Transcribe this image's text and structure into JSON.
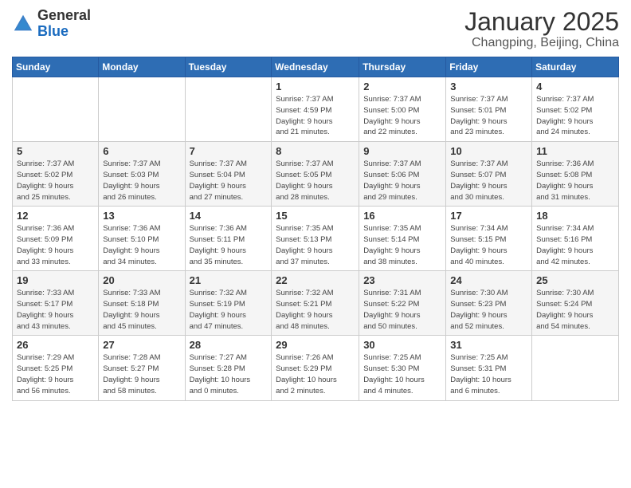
{
  "header": {
    "logo_general": "General",
    "logo_blue": "Blue",
    "month_year": "January 2025",
    "location": "Changping, Beijing, China"
  },
  "weekdays": [
    "Sunday",
    "Monday",
    "Tuesday",
    "Wednesday",
    "Thursday",
    "Friday",
    "Saturday"
  ],
  "weeks": [
    [
      {
        "day": "",
        "info": ""
      },
      {
        "day": "",
        "info": ""
      },
      {
        "day": "",
        "info": ""
      },
      {
        "day": "1",
        "info": "Sunrise: 7:37 AM\nSunset: 4:59 PM\nDaylight: 9 hours\nand 21 minutes."
      },
      {
        "day": "2",
        "info": "Sunrise: 7:37 AM\nSunset: 5:00 PM\nDaylight: 9 hours\nand 22 minutes."
      },
      {
        "day": "3",
        "info": "Sunrise: 7:37 AM\nSunset: 5:01 PM\nDaylight: 9 hours\nand 23 minutes."
      },
      {
        "day": "4",
        "info": "Sunrise: 7:37 AM\nSunset: 5:02 PM\nDaylight: 9 hours\nand 24 minutes."
      }
    ],
    [
      {
        "day": "5",
        "info": "Sunrise: 7:37 AM\nSunset: 5:02 PM\nDaylight: 9 hours\nand 25 minutes."
      },
      {
        "day": "6",
        "info": "Sunrise: 7:37 AM\nSunset: 5:03 PM\nDaylight: 9 hours\nand 26 minutes."
      },
      {
        "day": "7",
        "info": "Sunrise: 7:37 AM\nSunset: 5:04 PM\nDaylight: 9 hours\nand 27 minutes."
      },
      {
        "day": "8",
        "info": "Sunrise: 7:37 AM\nSunset: 5:05 PM\nDaylight: 9 hours\nand 28 minutes."
      },
      {
        "day": "9",
        "info": "Sunrise: 7:37 AM\nSunset: 5:06 PM\nDaylight: 9 hours\nand 29 minutes."
      },
      {
        "day": "10",
        "info": "Sunrise: 7:37 AM\nSunset: 5:07 PM\nDaylight: 9 hours\nand 30 minutes."
      },
      {
        "day": "11",
        "info": "Sunrise: 7:36 AM\nSunset: 5:08 PM\nDaylight: 9 hours\nand 31 minutes."
      }
    ],
    [
      {
        "day": "12",
        "info": "Sunrise: 7:36 AM\nSunset: 5:09 PM\nDaylight: 9 hours\nand 33 minutes."
      },
      {
        "day": "13",
        "info": "Sunrise: 7:36 AM\nSunset: 5:10 PM\nDaylight: 9 hours\nand 34 minutes."
      },
      {
        "day": "14",
        "info": "Sunrise: 7:36 AM\nSunset: 5:11 PM\nDaylight: 9 hours\nand 35 minutes."
      },
      {
        "day": "15",
        "info": "Sunrise: 7:35 AM\nSunset: 5:13 PM\nDaylight: 9 hours\nand 37 minutes."
      },
      {
        "day": "16",
        "info": "Sunrise: 7:35 AM\nSunset: 5:14 PM\nDaylight: 9 hours\nand 38 minutes."
      },
      {
        "day": "17",
        "info": "Sunrise: 7:34 AM\nSunset: 5:15 PM\nDaylight: 9 hours\nand 40 minutes."
      },
      {
        "day": "18",
        "info": "Sunrise: 7:34 AM\nSunset: 5:16 PM\nDaylight: 9 hours\nand 42 minutes."
      }
    ],
    [
      {
        "day": "19",
        "info": "Sunrise: 7:33 AM\nSunset: 5:17 PM\nDaylight: 9 hours\nand 43 minutes."
      },
      {
        "day": "20",
        "info": "Sunrise: 7:33 AM\nSunset: 5:18 PM\nDaylight: 9 hours\nand 45 minutes."
      },
      {
        "day": "21",
        "info": "Sunrise: 7:32 AM\nSunset: 5:19 PM\nDaylight: 9 hours\nand 47 minutes."
      },
      {
        "day": "22",
        "info": "Sunrise: 7:32 AM\nSunset: 5:21 PM\nDaylight: 9 hours\nand 48 minutes."
      },
      {
        "day": "23",
        "info": "Sunrise: 7:31 AM\nSunset: 5:22 PM\nDaylight: 9 hours\nand 50 minutes."
      },
      {
        "day": "24",
        "info": "Sunrise: 7:30 AM\nSunset: 5:23 PM\nDaylight: 9 hours\nand 52 minutes."
      },
      {
        "day": "25",
        "info": "Sunrise: 7:30 AM\nSunset: 5:24 PM\nDaylight: 9 hours\nand 54 minutes."
      }
    ],
    [
      {
        "day": "26",
        "info": "Sunrise: 7:29 AM\nSunset: 5:25 PM\nDaylight: 9 hours\nand 56 minutes."
      },
      {
        "day": "27",
        "info": "Sunrise: 7:28 AM\nSunset: 5:27 PM\nDaylight: 9 hours\nand 58 minutes."
      },
      {
        "day": "28",
        "info": "Sunrise: 7:27 AM\nSunset: 5:28 PM\nDaylight: 10 hours\nand 0 minutes."
      },
      {
        "day": "29",
        "info": "Sunrise: 7:26 AM\nSunset: 5:29 PM\nDaylight: 10 hours\nand 2 minutes."
      },
      {
        "day": "30",
        "info": "Sunrise: 7:25 AM\nSunset: 5:30 PM\nDaylight: 10 hours\nand 4 minutes."
      },
      {
        "day": "31",
        "info": "Sunrise: 7:25 AM\nSunset: 5:31 PM\nDaylight: 10 hours\nand 6 minutes."
      },
      {
        "day": "",
        "info": ""
      }
    ]
  ]
}
